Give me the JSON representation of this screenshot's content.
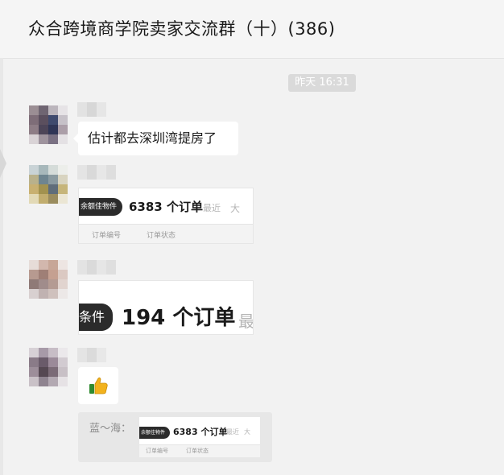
{
  "header": {
    "title": "众合跨境商学院卖家交流群（十）(386)"
  },
  "timestamp": "昨天 16:31",
  "messages": [
    {
      "text": "估计都去深圳湾提房了"
    },
    {
      "image": {
        "pill": "余额佳物件",
        "orders": "6383 个订单",
        "faded_1": "最近",
        "faded_2": "大",
        "strip_left": "订单编号",
        "strip_right": "订单状态"
      }
    },
    {
      "image": {
        "pill": "条件",
        "orders": "194 个订单",
        "faded": "最"
      }
    },
    {
      "emoji": "thumbs-up"
    }
  ],
  "quote": {
    "name": "蓝～海：",
    "image": {
      "pill": "余额佳物件",
      "orders": "6383 个订单",
      "faded_1": "最近",
      "faded_2": "大",
      "strip_left": "订单编号",
      "strip_right": "订单状态"
    }
  },
  "colors": {
    "background": "#f2f2f2",
    "bubble": "#ffffff",
    "timestamp_bg": "#dadada",
    "quote_bg": "#e7e7e7"
  }
}
